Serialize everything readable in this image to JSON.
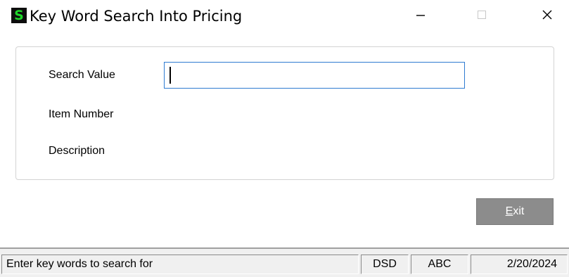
{
  "window": {
    "app_icon_letter": "S",
    "title": "Key Word Search Into Pricing"
  },
  "form": {
    "search_label": "Search Value",
    "search_value": "",
    "item_number_label": "Item Number",
    "description_label": "Description"
  },
  "buttons": {
    "exit_accel": "E",
    "exit_rest": "xit"
  },
  "status": {
    "message": "Enter key words to search for",
    "company": "DSD",
    "module": "ABC",
    "date": "2/20/2024"
  },
  "colors": {
    "icon_bg": "#0d0d0d",
    "icon_fg": "#1ed62a",
    "input_border": "#2e7bd1",
    "exit_bg": "#8c8c8c"
  },
  "icons": {
    "minimize": "minimize-icon",
    "maximize": "maximize-icon",
    "close": "close-icon"
  }
}
